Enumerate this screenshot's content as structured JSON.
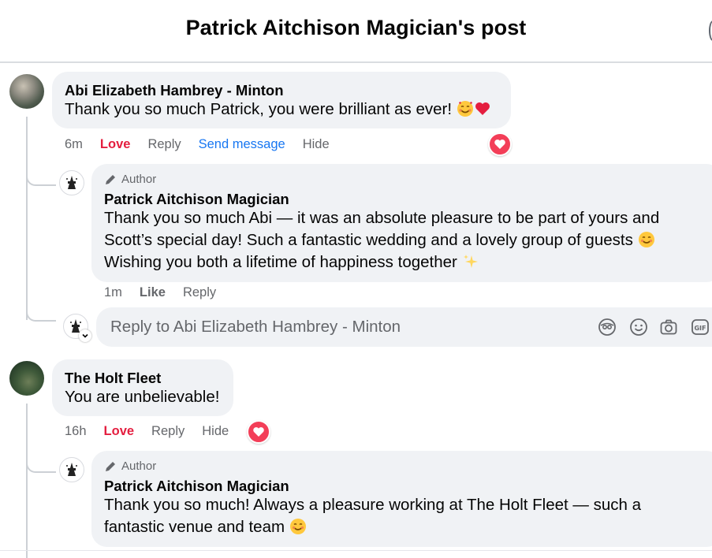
{
  "header": {
    "title": "Patrick Aitchison Magician's post"
  },
  "comments": [
    {
      "author": "Abi Elizabeth Hambrey - Minton",
      "text": "Thank you so much Patrick, you were brilliant as ever!",
      "time": "6m",
      "reaction_label": "Love",
      "reply_label": "Reply",
      "send_label": "Send message",
      "hide_label": "Hide",
      "reaction_icon": "love-heart",
      "reply": {
        "badge": "Author",
        "author": "Patrick Aitchison Magician",
        "lines": [
          "Thank you so much Abi — it was an absolute pleasure to be part of yours and",
          "Scott’s special day! Such a fantastic wedding and a lovely group of guests",
          "Wishing you both a lifetime of happiness together"
        ],
        "time": "1m",
        "like_label": "Like",
        "reply_label": "Reply"
      },
      "reply_box": {
        "placeholder": "Reply to Abi Elizabeth Hambrey - Minton"
      }
    },
    {
      "author": "The Holt Fleet",
      "text": "You are unbelievable!",
      "time": "16h",
      "reaction_label": "Love",
      "reply_label": "Reply",
      "hide_label": "Hide",
      "reaction_icon": "love-heart",
      "reply": {
        "badge": "Author",
        "author": "Patrick Aitchison Magician",
        "lines": [
          "Thank you so much! Always a pleasure working at The Holt Fleet — such a",
          "fantastic venue and team"
        ]
      }
    }
  ],
  "colors": {
    "love": "#e41e3f",
    "link": "#1877f2",
    "bubble": "#f0f2f5",
    "muted": "#65676b"
  }
}
